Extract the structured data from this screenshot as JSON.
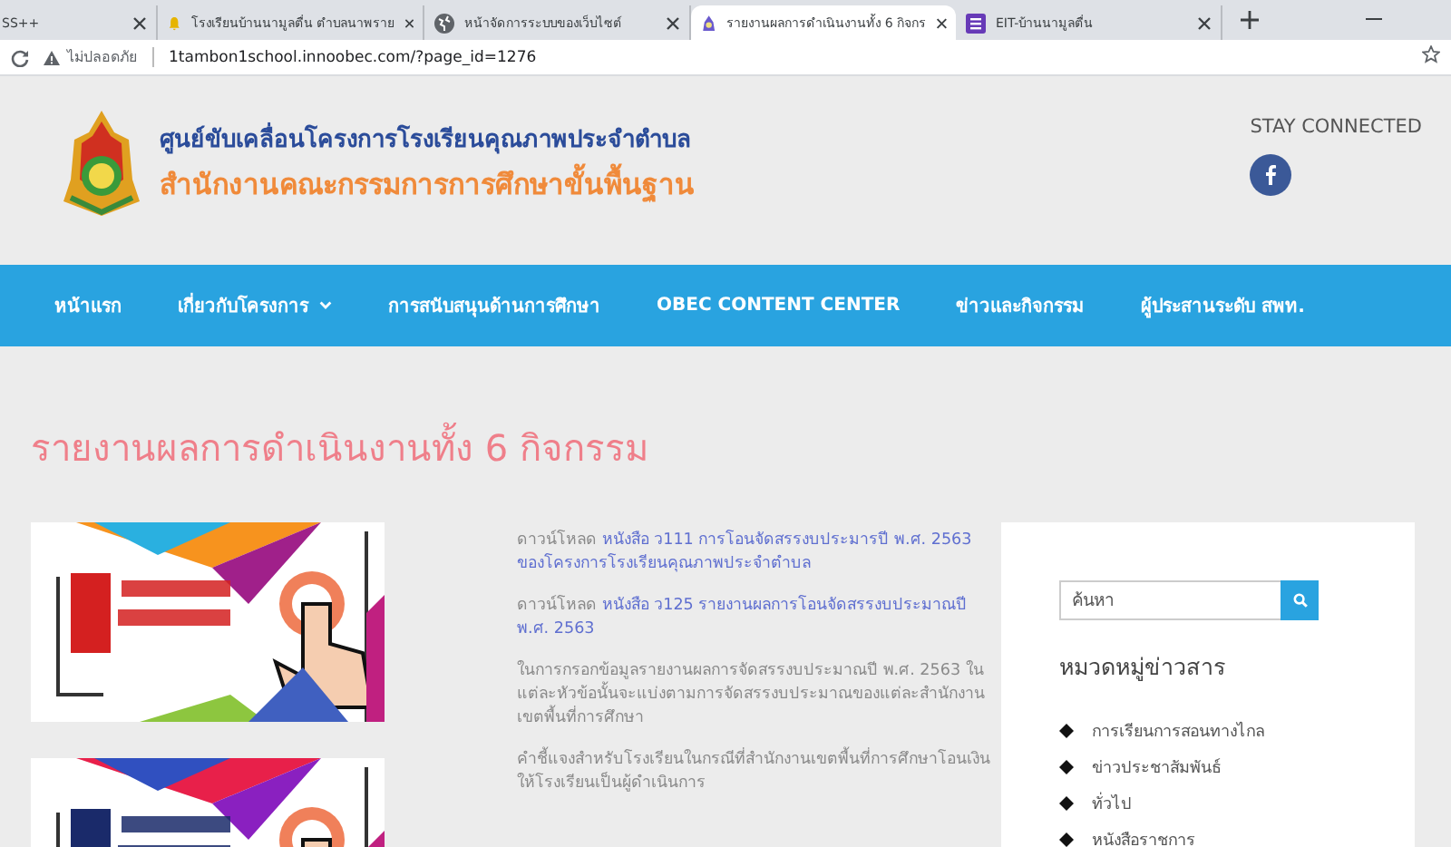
{
  "browser": {
    "tabs": [
      {
        "title": "SS++",
        "selected": false
      },
      {
        "title": "โรงเรียนบ้านนามูลตื่น ตำบลนาพราย",
        "selected": false
      },
      {
        "title": "หน้าจัดการระบบของเว็บไซต์",
        "selected": false
      },
      {
        "title": "รายงานผลการดำเนินงานทั้ง 6 กิจกร",
        "selected": true
      },
      {
        "title": "EIT-บ้านนามูลตื่น",
        "selected": false
      }
    ],
    "address": {
      "security": "ไม่ปลอดภัย",
      "url": "1tambon1school.innoobec.com/?page_id=1276"
    }
  },
  "header": {
    "title": "ศูนย์ขับเคลื่อนโครงการโรงเรียนคุณภาพประจำตำบล",
    "subtitle": "สำนักงานคณะกรรมการการศึกษาขั้นพื้นฐาน",
    "social_heading": "STAY CONNECTED"
  },
  "nav": [
    {
      "label": "หน้าแรก",
      "dropdown": false
    },
    {
      "label": "เกี่ยวกับโครงการ",
      "dropdown": true
    },
    {
      "label": "การสนับสนุนด้านการศึกษา",
      "dropdown": false
    },
    {
      "label": "OBEC CONTENT CENTER",
      "dropdown": false
    },
    {
      "label": "ข่าวและกิจกรรม",
      "dropdown": false
    },
    {
      "label": "ผู้ประสานระดับ สพท.",
      "dropdown": false
    }
  ],
  "page": {
    "title": "รายงานผลการดำเนินงานทั้ง 6 กิจกรรม",
    "paragraphs": [
      {
        "kind": "download",
        "prefix": "ดาวน์โหลด",
        "link": "หนังสือ ว111 การโอนจัดสรรงบประมารปี พ.ศ. 2563 ของโครงการโรงเรียนคุณภาพประจำตำบล"
      },
      {
        "kind": "download",
        "prefix": "ดาวน์โหลด",
        "link": "หนังสือ ว125 รายงานผลการโอนจัดสรรงบประมาณปี พ.ศ. 2563"
      },
      {
        "kind": "text",
        "text": "ในการกรอกข้อมูลรายงานผลการจัดสรรงบประมาณปี พ.ศ. 2563 ในแต่ละหัวข้อนั้นจะแบ่งตามการจัดสรรงบประมาณของแต่ละสำนักงานเขตพื้นที่การศึกษา"
      },
      {
        "kind": "text",
        "text": "คำชี้แจงสำหรับโรงเรียนในกรณีที่สำนักงานเขตพื้นที่การศึกษาโอนเงินให้โรงเรียนเป็นผู้ดำเนินการ"
      }
    ]
  },
  "sidebar": {
    "search": {
      "placeholder": "ค้นหา"
    },
    "categories_heading": "หมวดหมู่ข่าวสาร",
    "categories": [
      "การเรียนการสอนทางไกล",
      "ข่าวประชาสัมพันธ์",
      "ทั่วไป",
      "หนังสือราชการ"
    ]
  }
}
